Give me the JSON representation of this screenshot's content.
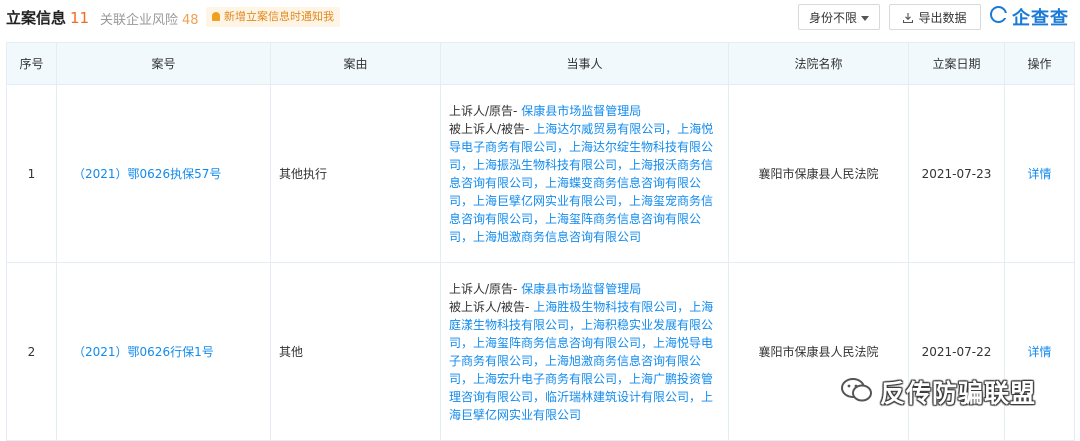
{
  "tabs": {
    "active": {
      "label": "立案信息",
      "count": "11"
    },
    "inactive": {
      "label": "关联企业风险",
      "count": "48"
    }
  },
  "notice": {
    "text": "新增立案信息时通知我",
    "icon": "bell-icon"
  },
  "toolbar": {
    "identity_label": "身份不限",
    "export_label": "导出数据",
    "logo_text": "企查查"
  },
  "table": {
    "headers": [
      "序号",
      "案号",
      "案由",
      "当事人",
      "法院名称",
      "立案日期",
      "操作"
    ],
    "rows": [
      {
        "no": "1",
        "case_no": "（2021）鄂0626执保57号",
        "reason": "其他执行",
        "plaintiff_role": "上诉人/原告-",
        "plaintiff": "保康县市场监督管理局",
        "defendant_role": "被上诉人/被告-",
        "defendants": "上海达尔威贸易有限公司，上海悦导电子商务有限公司，上海达尔绽生物科技有限公司，上海振泓生物科技有限公司，上海报沃商务信息咨询有限公司，上海蝶变商务信息咨询有限公司，上海巨擘亿网实业有限公司，上海玺宠商务信息咨询有限公司，上海玺阵商务信息咨询有限公司，上海旭激商务信息咨询有限公司",
        "court": "襄阳市保康县人民法院",
        "date": "2021-07-23",
        "action": "详情"
      },
      {
        "no": "2",
        "case_no": "（2021）鄂0626行保1号",
        "reason": "其他",
        "plaintiff_role": "上诉人/原告-",
        "plaintiff": "保康县市场监督管理局",
        "defendant_role": "被上诉人/被告-",
        "defendants": "上海胜极生物科技有限公司，上海庭漾生物科技有限公司，上海积稳实业发展有限公司，上海玺阵商务信息咨询有限公司，上海悦导电子商务有限公司，上海旭激商务信息咨询有限公司，上海宏升电子商务有限公司，上海广鹏投资管理咨询有限公司，临沂瑞林建筑设计有限公司，上海巨擘亿网实业有限公司",
        "court": "襄阳市保康县人民法院",
        "date": "2021-07-22",
        "action": "详情"
      }
    ]
  },
  "watermark": {
    "text": "反传防骗联盟",
    "icon": "wechat-icon"
  },
  "colors": {
    "accent": "#128bed",
    "count": "#f26c1e",
    "header_bg": "#f2f9fc",
    "border": "#e4ecf4"
  }
}
